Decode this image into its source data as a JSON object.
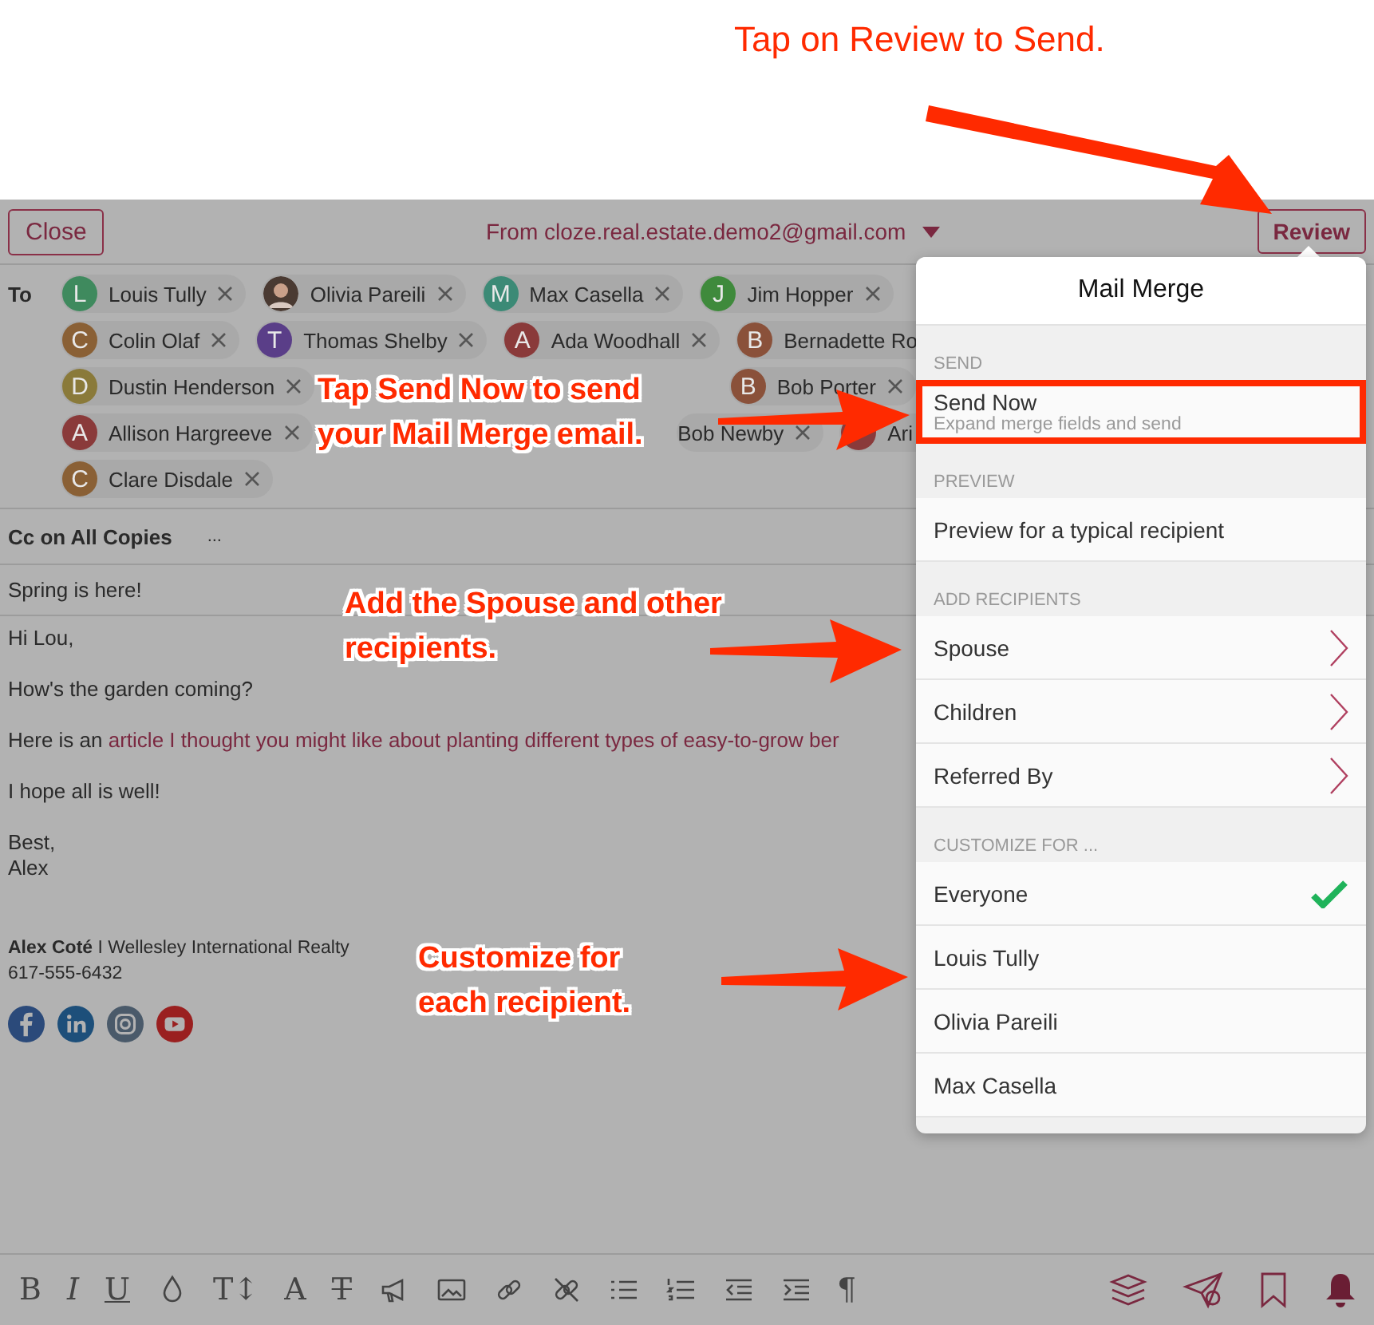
{
  "callouts": [
    {
      "kind": "plain",
      "text": "Tap on Review to Send."
    },
    {
      "kind": "outlined",
      "text": "Tap Send Now to send your Mail Merge email."
    },
    {
      "kind": "outlined",
      "text": "Add the Spouse and other recipients."
    },
    {
      "kind": "outlined",
      "text": "Customize for each recipient."
    }
  ],
  "header": {
    "close": "Close",
    "from": "From cloze.real.estate.demo2@gmail.com",
    "review": "Review"
  },
  "to_label": "To",
  "recipient_rows": [
    [
      {
        "letter": "L",
        "name": "Louis Tully",
        "color": "#3f8a5e"
      },
      {
        "kind": "photo",
        "name": "Olivia Pareili"
      },
      {
        "letter": "M",
        "name": "Max Casella",
        "color": "#3c8a76"
      },
      {
        "letter": "J",
        "name": "Jim Hopper",
        "color": "#3f8a3c"
      }
    ],
    [
      {
        "letter": "C",
        "name": "Colin Olaf",
        "color": "#8a6035"
      },
      {
        "letter": "T",
        "name": "Thomas Shelby",
        "color": "#5a3e88"
      },
      {
        "letter": "A",
        "name": "Ada Woodhall",
        "color": "#8a3a3a"
      },
      {
        "letter": "B",
        "name": "Bernadette Ro",
        "color": "#8a513a",
        "truncated": true
      }
    ],
    [
      {
        "letter": "D",
        "name": "Dustin Henderson",
        "color": "#8a7a3a"
      },
      {
        "letter": "B",
        "name": "Bob Porter",
        "color": "#8a513a"
      }
    ],
    [
      {
        "letter": "A",
        "name": "Allison Hargreeve",
        "color": "#8a3a3a"
      },
      {
        "name": "Bob Newby"
      },
      {
        "name": "Ari",
        "color": "#8a3a3a",
        "truncated": true
      }
    ],
    [
      {
        "letter": "C",
        "name": "Clare Disdale",
        "color": "#8a6035"
      }
    ]
  ],
  "cc": {
    "label": "Cc on All Copies",
    "more": "..."
  },
  "subject": "Spring is here!",
  "body": [
    {
      "kind": "text",
      "text": "Hi Lou,"
    },
    {
      "kind": "text",
      "text": "How's the garden coming?"
    },
    {
      "kind": "link",
      "prefix": "Here is an ",
      "link": "article I thought you might like about planting different types of easy-to-grow ber"
    },
    {
      "kind": "text",
      "text": "I hope all is well!"
    },
    {
      "kind": "lines",
      "lines": [
        "Best,",
        "Alex"
      ]
    }
  ],
  "signature": {
    "line": "**Alex Coté**  I Wellesley International Realty",
    "phone": "617-555-6432"
  },
  "toolbar": [
    {
      "kind": "glyph",
      "text": "B"
    },
    {
      "kind": "glyph",
      "text": "I"
    },
    {
      "kind": "glyph",
      "text": "U"
    },
    {
      "kind": "icon"
    },
    {
      "kind": "glyph",
      "text": "T↕"
    },
    {
      "kind": "glyph",
      "text": "A"
    },
    {
      "kind": "glyph",
      "text": "T"
    },
    {
      "kind": "icon"
    },
    {
      "kind": "icon"
    },
    {
      "kind": "icon"
    },
    {
      "kind": "icon"
    },
    {
      "kind": "icon"
    },
    {
      "kind": "icon"
    },
    {
      "kind": "icon"
    },
    {
      "kind": "icon"
    },
    {
      "kind": "glyph",
      "text": "¶"
    }
  ],
  "popover": {
    "title": "Mail Merge",
    "sections": [
      {
        "label": "SEND",
        "items": [
          {
            "kind": "action",
            "title": "Send Now",
            "subtitle": "Expand merge fields and send",
            "highlighted": true
          }
        ]
      },
      {
        "label": "PREVIEW",
        "items": [
          {
            "kind": "action",
            "title": "Preview for a typical recipient"
          }
        ]
      },
      {
        "label": "ADD RECIPIENTS",
        "items": [
          {
            "kind": "submenu",
            "title": "Spouse"
          },
          {
            "kind": "submenu",
            "title": "Children"
          },
          {
            "kind": "submenu",
            "title": "Referred By"
          }
        ]
      },
      {
        "label": "CUSTOMIZE FOR ...",
        "items": [
          {
            "kind": "option",
            "title": "Everyone",
            "selected": true
          },
          {
            "kind": "option",
            "title": "Louis Tully",
            "selected": false
          },
          {
            "kind": "option",
            "title": "Olivia Pareili",
            "selected": false
          },
          {
            "kind": "option",
            "title": "Max Casella",
            "selected": false
          }
        ]
      }
    ]
  }
}
